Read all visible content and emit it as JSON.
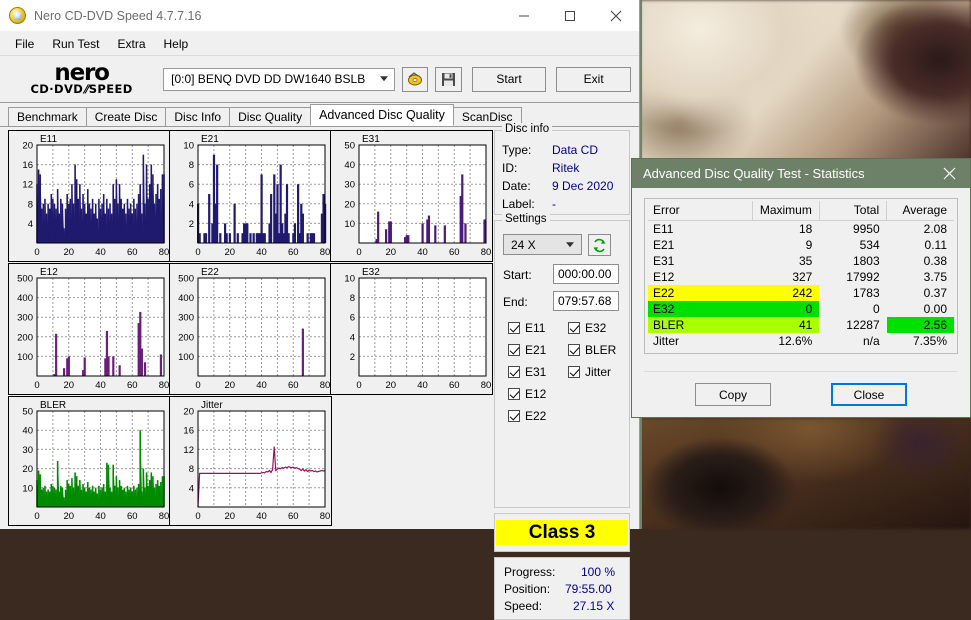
{
  "window": {
    "title": "Nero CD-DVD Speed 4.7.7.16",
    "app_icon": "nero-disc-icon",
    "minimize_label": "minimize-icon",
    "maximize_label": "maximize-icon",
    "close_label": "close-icon"
  },
  "menu": [
    "File",
    "Run Test",
    "Extra",
    "Help"
  ],
  "toolbar": {
    "logo_line1": "nero",
    "logo_line2_a": "CD·DVD",
    "logo_line2_b": "SPEED",
    "drive": "[0:0]   BENQ DVD DD DW1640 BSLB",
    "disc_icon": "disc-eject-icon",
    "save_icon": "floppy-save-icon",
    "start_label": "Start",
    "exit_label": "Exit"
  },
  "tabs": [
    {
      "label": "Benchmark",
      "active": false
    },
    {
      "label": "Create Disc",
      "active": false
    },
    {
      "label": "Disc Info",
      "active": false
    },
    {
      "label": "Disc Quality",
      "active": false
    },
    {
      "label": "Advanced Disc Quality",
      "active": true
    },
    {
      "label": "ScanDisc",
      "active": false
    }
  ],
  "disc_info": {
    "legend": "Disc info",
    "rows": [
      {
        "key": "Type:",
        "value": "Data CD"
      },
      {
        "key": "ID:",
        "value": "Ritek"
      },
      {
        "key": "Date:",
        "value": "9 Dec 2020"
      },
      {
        "key": "Label:",
        "value": "-"
      }
    ]
  },
  "settings": {
    "legend": "Settings",
    "speed": "24 X",
    "refresh_icon": "refresh-arrows-icon",
    "start_label": "Start:",
    "start_value": "000:00.00",
    "end_label": "End:",
    "end_value": "079:57.68",
    "checkboxes_left": [
      "E11",
      "E21",
      "E31",
      "E12",
      "E22"
    ],
    "checkboxes_right": [
      "E32",
      "BLER",
      "Jitter"
    ]
  },
  "class_rating": {
    "label": "Class 3",
    "color": "#ffff00"
  },
  "progress": {
    "rows": [
      {
        "key": "Progress:",
        "value": "100 %"
      },
      {
        "key": "Position:",
        "value": "79:55.00"
      },
      {
        "key": "Speed:",
        "value": "27.15 X"
      }
    ]
  },
  "dialog": {
    "title": "Advanced Disc Quality Test - Statistics",
    "close_icon": "close-icon",
    "header_color": "#6d8168",
    "columns": [
      "Error",
      "Maximum",
      "Total",
      "Average"
    ],
    "rows": [
      {
        "error": "E11",
        "maximum": "18",
        "total": "9950",
        "average": "2.08",
        "highlight": null
      },
      {
        "error": "E21",
        "maximum": "9",
        "total": "534",
        "average": "0.11",
        "highlight": null
      },
      {
        "error": "E31",
        "maximum": "35",
        "total": "1803",
        "average": "0.38",
        "highlight": null
      },
      {
        "error": "E12",
        "maximum": "327",
        "total": "17992",
        "average": "3.75",
        "highlight": null
      },
      {
        "error": "E22",
        "maximum": "242",
        "total": "1783",
        "average": "0.37",
        "highlight": "#ffff00",
        "highlight_span": "error-max"
      },
      {
        "error": "E32",
        "maximum": "0",
        "total": "0",
        "average": "0.00",
        "highlight": "#00e000",
        "highlight_span": "error-max"
      },
      {
        "error": "BLER",
        "maximum": "41",
        "total": "12287",
        "average": "2.56",
        "highlight": "#aaff00",
        "highlight_span": "error-max",
        "average_highlight": "#00e000"
      },
      {
        "error": "Jitter",
        "maximum": "12.6%",
        "total": "n/a",
        "average": "7.35%",
        "highlight": null
      }
    ],
    "copy_label": "Copy",
    "close_label": "Close"
  },
  "chart_data": [
    {
      "type": "area",
      "title": "E11",
      "color": "#201a6e",
      "xlabel": "",
      "ylabel": "",
      "xlim": [
        0,
        80
      ],
      "ylim": [
        0,
        20
      ],
      "xticks": [
        0,
        20,
        40,
        60,
        80
      ],
      "yticks": [
        4,
        8,
        12,
        16,
        20
      ],
      "grid": true,
      "x": [
        0,
        1,
        2,
        3,
        4,
        5,
        6,
        7,
        8,
        9,
        10,
        11,
        12,
        13,
        14,
        15,
        16,
        17,
        18,
        19,
        20,
        21,
        22,
        23,
        24,
        25,
        26,
        27,
        28,
        29,
        30,
        31,
        32,
        33,
        34,
        35,
        36,
        37,
        38,
        39,
        40,
        41,
        42,
        43,
        44,
        45,
        46,
        47,
        48,
        49,
        50,
        51,
        52,
        53,
        54,
        55,
        56,
        57,
        58,
        59,
        60,
        61,
        62,
        63,
        64,
        65,
        66,
        67,
        68,
        69,
        70,
        71,
        72,
        73,
        74,
        75,
        76,
        77,
        78,
        79,
        80
      ],
      "values": [
        12,
        15,
        14,
        7,
        8,
        9,
        6,
        8,
        7,
        10,
        9,
        8,
        7,
        11,
        6,
        9,
        8,
        3,
        7,
        10,
        8,
        9,
        12,
        8,
        16,
        13,
        9,
        12,
        7,
        10,
        8,
        6,
        11,
        8,
        7,
        9,
        6,
        8,
        5,
        9,
        7,
        8,
        10,
        6,
        9,
        7,
        8,
        6,
        12,
        9,
        13,
        8,
        12,
        9,
        7,
        8,
        6,
        9,
        7,
        8,
        6,
        9,
        7,
        8,
        10,
        12,
        6,
        18,
        8,
        16,
        9,
        12,
        16,
        14,
        8,
        10,
        12,
        9,
        11,
        14,
        14
      ]
    },
    {
      "type": "bar",
      "title": "E21",
      "color": "#201a6e",
      "xlabel": "",
      "ylabel": "",
      "xlim": [
        0,
        80
      ],
      "ylim": [
        0,
        10
      ],
      "xticks": [
        0,
        20,
        40,
        60,
        80
      ],
      "yticks": [
        2,
        4,
        6,
        8,
        10
      ],
      "grid": true,
      "x": [
        0,
        1,
        2,
        3,
        4,
        5,
        6,
        7,
        8,
        9,
        10,
        11,
        12,
        13,
        14,
        15,
        16,
        17,
        18,
        19,
        20,
        21,
        22,
        23,
        24,
        25,
        26,
        27,
        28,
        29,
        30,
        31,
        32,
        33,
        34,
        35,
        36,
        37,
        38,
        39,
        40,
        41,
        42,
        43,
        44,
        45,
        46,
        47,
        48,
        49,
        50,
        51,
        52,
        53,
        54,
        55,
        56,
        57,
        58,
        59,
        60,
        61,
        62,
        63,
        64,
        65,
        66,
        67,
        68,
        69,
        70,
        71,
        72,
        73,
        74,
        75,
        76,
        77,
        78,
        79,
        80
      ],
      "values": [
        4,
        1,
        0,
        0,
        1,
        1,
        0,
        5,
        0,
        2,
        9,
        4,
        8,
        0,
        1,
        0,
        0,
        2,
        1,
        0,
        1,
        0,
        0,
        4,
        0,
        1,
        0,
        0,
        1,
        2,
        2,
        2,
        0,
        1,
        0,
        1,
        0,
        1,
        1,
        1,
        7,
        1,
        1,
        0,
        0,
        2,
        5,
        0,
        7,
        3,
        6,
        1,
        8,
        2,
        1,
        3,
        6,
        1,
        0,
        0,
        1,
        2,
        0,
        6,
        1,
        4,
        3,
        0,
        0,
        1,
        0,
        1,
        1,
        1,
        0,
        0,
        0,
        0,
        3,
        5,
        4
      ]
    },
    {
      "type": "bar",
      "title": "E31",
      "color": "#4b1a7a",
      "xlabel": "",
      "ylabel": "",
      "xlim": [
        0,
        80
      ],
      "ylim": [
        0,
        50
      ],
      "xticks": [
        0,
        20,
        40,
        60,
        80
      ],
      "yticks": [
        10,
        20,
        30,
        40,
        50
      ],
      "grid": true,
      "x": [
        0,
        1,
        2,
        3,
        4,
        5,
        6,
        7,
        8,
        9,
        10,
        11,
        12,
        13,
        14,
        15,
        16,
        17,
        18,
        19,
        20,
        21,
        22,
        23,
        24,
        25,
        26,
        27,
        28,
        29,
        30,
        31,
        32,
        33,
        34,
        35,
        36,
        37,
        38,
        39,
        40,
        41,
        42,
        43,
        44,
        45,
        46,
        47,
        48,
        49,
        50,
        51,
        52,
        53,
        54,
        55,
        56,
        57,
        58,
        59,
        60,
        61,
        62,
        63,
        64,
        65,
        66,
        67,
        68,
        69,
        70,
        71,
        72,
        73,
        74,
        75,
        76,
        77,
        78,
        79,
        80
      ],
      "values": [
        0,
        0,
        0,
        0,
        0,
        0,
        0,
        0,
        0,
        0,
        0,
        2,
        16,
        0,
        0,
        0,
        0,
        7,
        0,
        11,
        11,
        0,
        0,
        0,
        0,
        0,
        0,
        0,
        0,
        3,
        4,
        4,
        0,
        0,
        0,
        0,
        0,
        0,
        0,
        0,
        10,
        0,
        0,
        12,
        14,
        0,
        0,
        0,
        9,
        0,
        0,
        0,
        0,
        0,
        9,
        0,
        0,
        0,
        0,
        0,
        0,
        0,
        0,
        0,
        24,
        35,
        0,
        10,
        0,
        0,
        0,
        0,
        0,
        0,
        0,
        0,
        0,
        0,
        0,
        12,
        0
      ]
    },
    {
      "type": "bar",
      "title": "E12",
      "color": "#6b1f7a",
      "xlabel": "",
      "ylabel": "",
      "xlim": [
        0,
        80
      ],
      "ylim": [
        0,
        500
      ],
      "xticks": [
        0,
        20,
        40,
        60,
        80
      ],
      "yticks": [
        100,
        200,
        300,
        400,
        500
      ],
      "grid": true,
      "x": [
        0,
        1,
        2,
        3,
        4,
        5,
        6,
        7,
        8,
        9,
        10,
        11,
        12,
        13,
        14,
        15,
        16,
        17,
        18,
        19,
        20,
        21,
        22,
        23,
        24,
        25,
        26,
        27,
        28,
        29,
        30,
        31,
        32,
        33,
        34,
        35,
        36,
        37,
        38,
        39,
        40,
        41,
        42,
        43,
        44,
        45,
        46,
        47,
        48,
        49,
        50,
        51,
        52,
        53,
        54,
        55,
        56,
        57,
        58,
        59,
        60,
        61,
        62,
        63,
        64,
        65,
        66,
        67,
        68,
        69,
        70,
        71,
        72,
        73,
        74,
        75,
        76,
        77,
        78,
        79,
        80
      ],
      "values": [
        0,
        0,
        0,
        0,
        0,
        0,
        0,
        0,
        0,
        0,
        0,
        10,
        215,
        0,
        0,
        0,
        0,
        40,
        0,
        90,
        100,
        0,
        0,
        0,
        0,
        0,
        0,
        0,
        0,
        30,
        95,
        0,
        0,
        0,
        0,
        0,
        0,
        0,
        0,
        0,
        0,
        0,
        0,
        90,
        230,
        100,
        0,
        0,
        100,
        0,
        0,
        0,
        55,
        0,
        0,
        0,
        0,
        0,
        0,
        0,
        0,
        0,
        0,
        0,
        270,
        327,
        140,
        0,
        70,
        0,
        0,
        0,
        0,
        0,
        0,
        0,
        0,
        0,
        110,
        0,
        0
      ]
    },
    {
      "type": "bar",
      "title": "E22",
      "color": "#6b1f7a",
      "xlabel": "",
      "ylabel": "",
      "xlim": [
        0,
        80
      ],
      "ylim": [
        0,
        500
      ],
      "xticks": [
        0,
        20,
        40,
        60,
        80
      ],
      "yticks": [
        100,
        200,
        300,
        400,
        500
      ],
      "grid": true,
      "x": [
        66
      ],
      "values": [
        242
      ]
    },
    {
      "type": "bar",
      "title": "E32",
      "color": "#6b1f7a",
      "xlabel": "",
      "ylabel": "",
      "xlim": [
        0,
        80
      ],
      "ylim": [
        0,
        10
      ],
      "xticks": [
        0,
        20,
        40,
        60,
        80
      ],
      "yticks": [
        2,
        4,
        6,
        8,
        10
      ],
      "grid": true,
      "x": [],
      "values": []
    },
    {
      "type": "area",
      "title": "BLER",
      "color": "#008a00",
      "xlabel": "",
      "ylabel": "",
      "xlim": [
        0,
        80
      ],
      "ylim": [
        0,
        50
      ],
      "xticks": [
        0,
        20,
        40,
        60,
        80
      ],
      "yticks": [
        10,
        20,
        30,
        40,
        50
      ],
      "grid": true,
      "x": [
        0,
        1,
        2,
        3,
        4,
        5,
        6,
        7,
        8,
        9,
        10,
        11,
        12,
        13,
        14,
        15,
        16,
        17,
        18,
        19,
        20,
        21,
        22,
        23,
        24,
        25,
        26,
        27,
        28,
        29,
        30,
        31,
        32,
        33,
        34,
        35,
        36,
        37,
        38,
        39,
        40,
        41,
        42,
        43,
        44,
        45,
        46,
        47,
        48,
        49,
        50,
        51,
        52,
        53,
        54,
        55,
        56,
        57,
        58,
        59,
        60,
        61,
        62,
        63,
        64,
        65,
        66,
        67,
        68,
        69,
        70,
        71,
        72,
        73,
        74,
        75,
        76,
        77,
        78,
        79,
        80
      ],
      "values": [
        14,
        19,
        17,
        9,
        10,
        11,
        8,
        9,
        8,
        12,
        11,
        10,
        9,
        24,
        8,
        11,
        10,
        5,
        9,
        14,
        12,
        11,
        15,
        10,
        18,
        16,
        11,
        14,
        9,
        12,
        10,
        8,
        13,
        10,
        9,
        11,
        8,
        10,
        7,
        11,
        9,
        10,
        12,
        8,
        23,
        22,
        10,
        8,
        22,
        11,
        16,
        10,
        14,
        11,
        9,
        10,
        8,
        11,
        9,
        10,
        8,
        11,
        9,
        10,
        12,
        40,
        8,
        20,
        10,
        18,
        11,
        14,
        18,
        16,
        10,
        12,
        14,
        11,
        13,
        16,
        16
      ]
    },
    {
      "type": "line",
      "title": "Jitter",
      "color": "#9b1060",
      "xlabel": "",
      "ylabel": "",
      "xlim": [
        0,
        80
      ],
      "ylim": [
        0,
        20
      ],
      "xticks": [
        0,
        20,
        40,
        60,
        80
      ],
      "yticks": [
        4,
        8,
        12,
        16,
        20
      ],
      "grid": true,
      "x": [
        0,
        1,
        2,
        3,
        4,
        5,
        6,
        7,
        8,
        9,
        10,
        11,
        12,
        13,
        14,
        15,
        16,
        17,
        18,
        19,
        20,
        21,
        22,
        23,
        24,
        25,
        26,
        27,
        28,
        29,
        30,
        31,
        32,
        33,
        34,
        35,
        36,
        37,
        38,
        39,
        40,
        41,
        42,
        43,
        44,
        45,
        46,
        47,
        48,
        49,
        50,
        51,
        52,
        53,
        54,
        55,
        56,
        57,
        58,
        59,
        60,
        61,
        62,
        63,
        64,
        65,
        66,
        67,
        68,
        69,
        70,
        71,
        72,
        73,
        74,
        75,
        76,
        77,
        78,
        79,
        80
      ],
      "values": [
        0,
        7,
        7,
        7,
        7,
        7,
        7,
        7,
        7,
        7,
        7,
        7,
        7,
        7,
        7,
        7,
        7,
        7,
        7,
        7,
        7,
        7,
        7,
        7,
        7,
        7,
        7,
        7,
        7,
        7,
        7,
        7,
        7,
        7,
        7,
        7,
        7,
        7,
        7,
        7,
        7.1,
        7.2,
        7.1,
        7.4,
        7.3,
        7.6,
        7.2,
        7.8,
        12.6,
        7.6,
        7.9,
        8.1,
        8.0,
        8.2,
        8.1,
        8.3,
        8.2,
        8.4,
        8.3,
        8.2,
        8.3,
        8.1,
        8.2,
        8.0,
        7.9,
        7.6,
        7.9,
        7.5,
        7.8,
        7.4,
        7.7,
        7.5,
        7.6,
        7.4,
        7.5,
        7.3,
        7.4,
        7.5,
        7.6,
        7.5,
        7.6
      ]
    }
  ]
}
